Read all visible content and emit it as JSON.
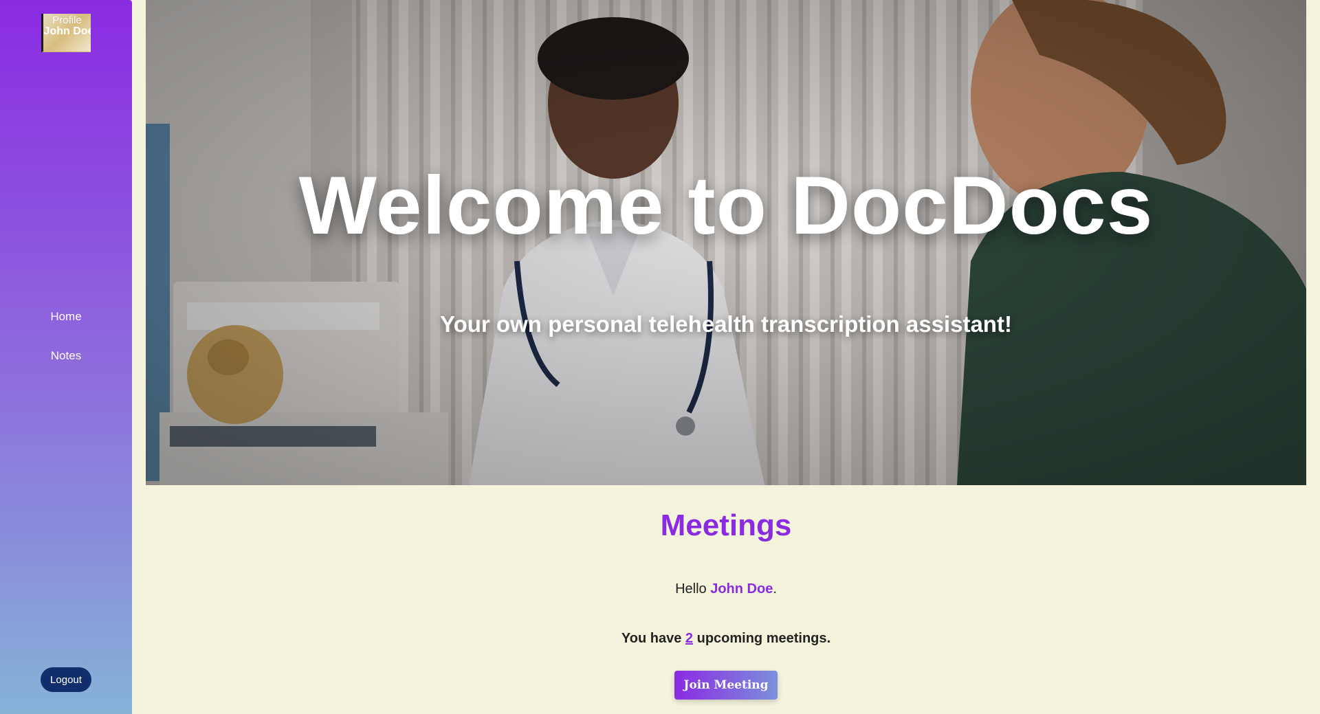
{
  "sidebar": {
    "profile_label": "Profile",
    "profile_name": "John Doe",
    "nav": [
      {
        "label": "Home"
      },
      {
        "label": "Notes"
      }
    ],
    "logout_label": "Logout"
  },
  "hero": {
    "title": "Welcome to DocDocs",
    "subtitle": "Your own personal telehealth transcription assistant!"
  },
  "meetings": {
    "heading": "Meetings",
    "greeting_prefix": "Hello ",
    "user_name": "John Doe",
    "greeting_suffix": ".",
    "upcoming_prefix": "You have ",
    "upcoming_count": "2",
    "upcoming_suffix": " upcoming meetings.",
    "join_button": "Join Meeting"
  },
  "colors": {
    "accent": "#8a2be2",
    "background": "#f4f3dc",
    "logout_bg": "#0f2e6b"
  }
}
